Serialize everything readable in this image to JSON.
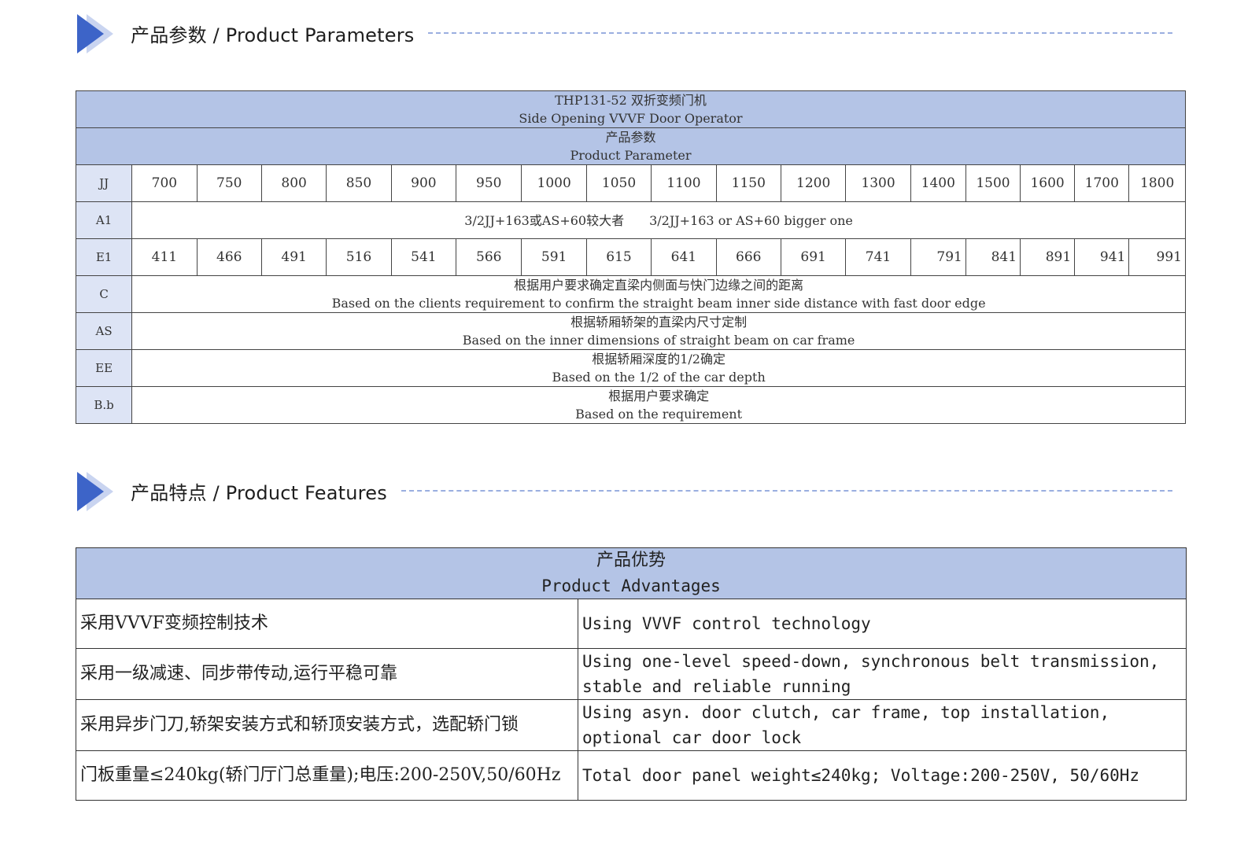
{
  "parameters_section": {
    "title": "产品参数 / Product Parameters",
    "table": {
      "title_cn": "THP131-52 双折变频门机",
      "title_en": "Side Opening VVVF Door Operator",
      "subtitle_cn": "产品参数",
      "subtitle_en": "Product Parameter",
      "jj": {
        "label": "JJ",
        "values": [
          "700",
          "750",
          "800",
          "850",
          "900",
          "950",
          "1000",
          "1050",
          "1100",
          "1150",
          "1200",
          "1300",
          "1400",
          "1500",
          "1600",
          "1700",
          "1800"
        ]
      },
      "a1": {
        "label": "A1",
        "text": "3/2JJ+163或AS+60较大者　　3/2JJ+163 or AS+60 bigger one"
      },
      "e1": {
        "label": "E1",
        "values": [
          "411",
          "466",
          "491",
          "516",
          "541",
          "566",
          "591",
          "615",
          "641",
          "666",
          "691",
          "741",
          "791",
          "841",
          "891",
          "941",
          "991"
        ]
      },
      "c": {
        "label": "C",
        "cn": "根据用户要求确定直梁内侧面与快门边缘之间的距离",
        "en": "Based on the clients requirement to confirm the straight beam inner side distance with fast door edge"
      },
      "as": {
        "label": "AS",
        "cn": "根据轿厢轿架的直梁内尺寸定制",
        "en": "Based on the inner dimensions of straight beam on car frame"
      },
      "ee": {
        "label": "EE",
        "cn": "根据轿厢深度的1/2确定",
        "en": "Based on the 1/2 of the car depth"
      },
      "bb": {
        "label": "B.b",
        "cn": "根据用户要求确定",
        "en": "Based on the requirement"
      }
    }
  },
  "features_section": {
    "title": "产品特点 / Product Features",
    "table": {
      "header_cn": "产品优势",
      "header_en": "Product Advantages",
      "rows": [
        {
          "cn": "采用VVVF变频控制技术",
          "en": "Using VVVF control technology"
        },
        {
          "cn": "采用一级减速、同步带传动,运行平稳可靠",
          "en": "Using one-level speed-down, synchronous belt transmission, stable and reliable running"
        },
        {
          "cn": "采用异步门刀,轿架安装方式和轿顶安装方式，选配轿门锁",
          "en": "Using asyn. door clutch, car frame, top installation, optional car door lock"
        },
        {
          "cn": "门板重量≤240kg(轿门厅门总重量);电压:200-250V,50/60Hz",
          "en": "Total door panel weight≤240kg; Voltage:200-250V, 50/60Hz"
        }
      ]
    }
  },
  "colors": {
    "accent": "#3d64c8",
    "accent_light": "#c9d4f0",
    "header_bg": "#b4c4e6",
    "label_bg": "#dde4f5"
  },
  "icons": [
    "section-arrow-icon"
  ]
}
